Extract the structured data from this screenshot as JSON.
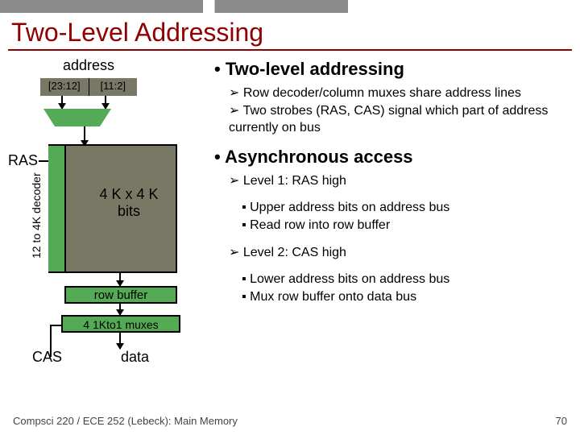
{
  "slide": {
    "title": "Two-Level Addressing",
    "footer_left": "Compsci 220 / ECE 252 (Lebeck): Main Memory",
    "footer_right": "70"
  },
  "diagram": {
    "address_label": "address",
    "bits_hi": "[23:12]",
    "bits_lo": "[11:2]",
    "ras": "RAS",
    "cas": "CAS",
    "decoder": "12 to 4K decoder",
    "mem_array": "4 K x 4 K bits",
    "row_buffer": "row buffer",
    "col_mux": "4 1Kto1 muxes",
    "data": "data"
  },
  "content": {
    "h1": "Two-level addressing",
    "p1a": "Row decoder/column muxes share address lines",
    "p1b": "Two strobes (RAS, CAS) signal which part of address currently on bus",
    "h2": "Asynchronous access",
    "p2a": "Level 1: RAS high",
    "p2a1": "Upper address bits on address bus",
    "p2a2": "Read row into row buffer",
    "p2b": "Level 2: CAS high",
    "p2b1": "Lower address bits on address bus",
    "p2b2": "Mux row buffer onto data bus"
  }
}
